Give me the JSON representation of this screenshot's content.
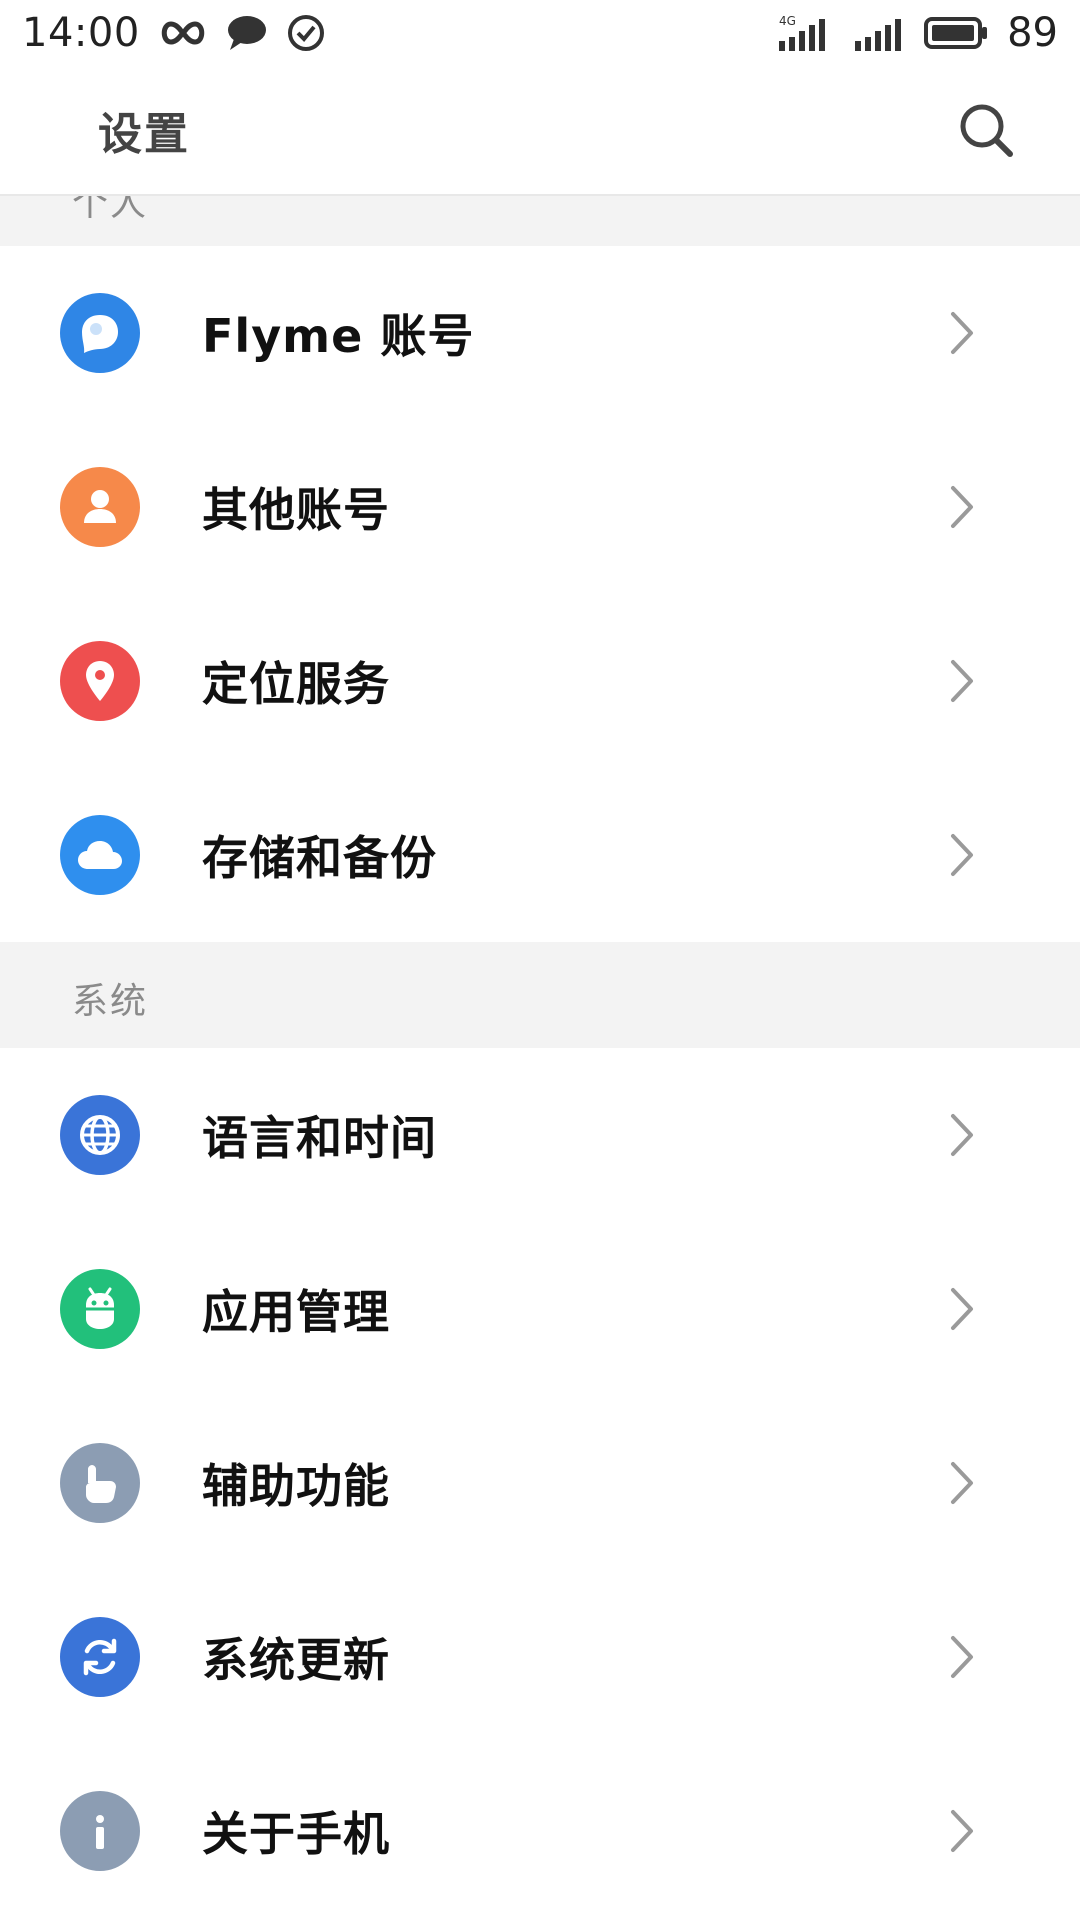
{
  "status_bar": {
    "time": "14:00",
    "network_label": "4G",
    "battery_level": "89",
    "icons": [
      "infinity-icon",
      "message-icon",
      "check-circle-icon",
      "signal-4g-icon",
      "signal-icon",
      "battery-icon"
    ]
  },
  "header": {
    "title": "设置",
    "search_icon": "search-icon"
  },
  "sections": [
    {
      "title": "个人",
      "items": [
        {
          "label": "Flyme 账号",
          "icon": "flyme-account-icon",
          "color": "#2f86e6"
        },
        {
          "label": "其他账号",
          "icon": "user-icon",
          "color": "#f6894a"
        },
        {
          "label": "定位服务",
          "icon": "location-pin-icon",
          "color": "#ee4f4f"
        },
        {
          "label": "存储和备份",
          "icon": "cloud-icon",
          "color": "#2f8fee"
        }
      ]
    },
    {
      "title": "系统",
      "items": [
        {
          "label": "语言和时间",
          "icon": "globe-icon",
          "color": "#3a74d8"
        },
        {
          "label": "应用管理",
          "icon": "android-icon",
          "color": "#22c07b"
        },
        {
          "label": "辅助功能",
          "icon": "hand-pointer-icon",
          "color": "#8c9db3"
        },
        {
          "label": "系统更新",
          "icon": "sync-icon",
          "color": "#3a74d8"
        },
        {
          "label": "关于手机",
          "icon": "info-icon",
          "color": "#8c9db3"
        }
      ]
    }
  ]
}
